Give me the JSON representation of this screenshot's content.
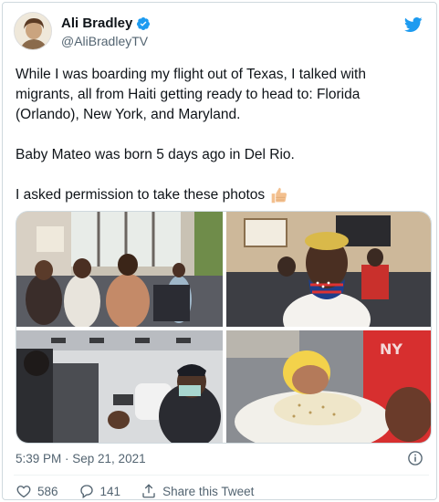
{
  "tweet": {
    "author": {
      "display_name": "Ali Bradley",
      "handle": "@AliBradleyTV",
      "verified": true
    },
    "paragraphs": [
      "While I was boarding my flight out of Texas, I talked with migrants, all from Haiti getting ready to head to: Florida (Orlando), New York, and Maryland.",
      "Baby Mateo was born 5 days ago in Del Rio."
    ],
    "last_line": "I asked permission to take these photos",
    "last_line_emoji": "thumbs-up-icon",
    "timestamp": "5:39 PM · Sep 21, 2021",
    "actions": {
      "likes": "586",
      "replies": "141",
      "share_label": "Share this Tweet"
    },
    "photos": [
      "airport-gate-migrants-photo",
      "man-in-flag-mask-photo",
      "airplane-cabin-photo",
      "newborn-baby-photo"
    ]
  },
  "colors": {
    "brand_blue": "#1d9bf0",
    "secondary_text": "#536471",
    "border": "#cfd9de"
  }
}
